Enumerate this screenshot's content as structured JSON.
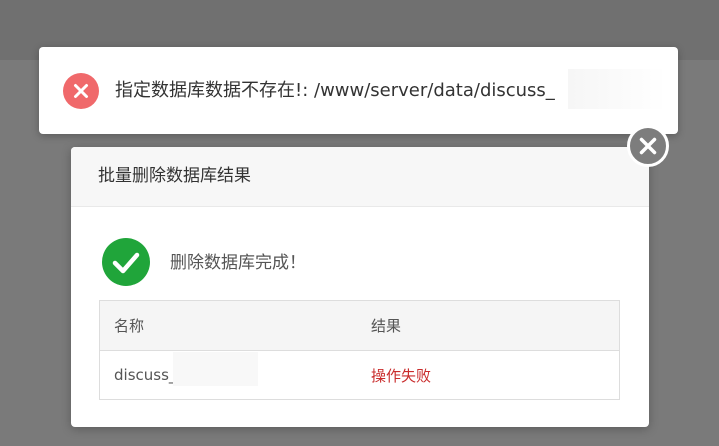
{
  "toast": {
    "message": "指定数据库数据不存在!: /www/server/data/discuss_",
    "icon": "error-circle-icon",
    "color": "#f0696b"
  },
  "dialog": {
    "title": "批量删除数据库结果",
    "close_icon": "close-icon",
    "status_icon": "check-circle-icon",
    "status_text": "删除数据库完成！",
    "status_color": "#20a53a",
    "table": {
      "headers": [
        "名称",
        "结果"
      ],
      "rows": [
        {
          "name": "discuss_",
          "result": "操作失败"
        }
      ]
    },
    "fail_color": "#c92c2c"
  }
}
